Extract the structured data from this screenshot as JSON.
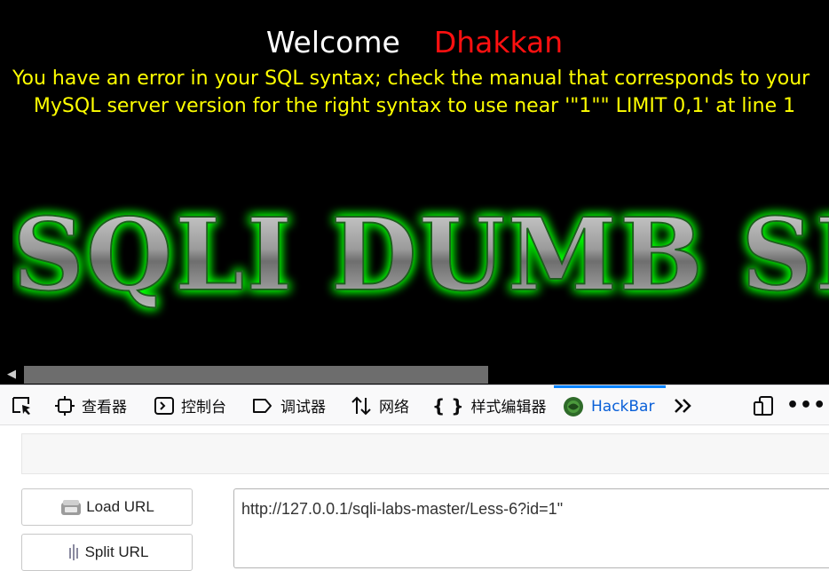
{
  "page": {
    "welcome_label": "Welcome",
    "user_name": "Dhakkan",
    "error_line1": "You have an error in your SQL syntax; check the manual that corresponds to your",
    "error_line2": "MySQL server version for the right syntax to use near '\"1\"\" LIMIT 0,1' at line 1",
    "banner_text": "SQLI DUMB SERIES"
  },
  "devtools": {
    "tabs": [
      {
        "label": "",
        "icon": "element-picker-icon"
      },
      {
        "label": "查看器",
        "icon": "inspector-icon"
      },
      {
        "label": "控制台",
        "icon": "console-icon"
      },
      {
        "label": "调试器",
        "icon": "debugger-icon"
      },
      {
        "label": "网络",
        "icon": "network-icon"
      },
      {
        "label": "样式编辑器",
        "icon": "braces-icon"
      },
      {
        "label": "HackBar",
        "icon": "hackbar-icon",
        "active": true
      }
    ],
    "overflow_icon": "double-chevron-right-icon",
    "responsive_icon": "responsive-design-icon",
    "menu_label": "•••"
  },
  "hackbar": {
    "load_url_label": "Load URL",
    "split_url_label": "Split URL",
    "url_value": "http://127.0.0.1/sqli-labs-master/Less-6?id=1\""
  },
  "colors": {
    "background": "#000000",
    "welcome": "#ffffff",
    "name": "#ff1010",
    "error": "#ffff00",
    "banner_glow": "#00ff00",
    "active_tab": "#0a84ff"
  }
}
